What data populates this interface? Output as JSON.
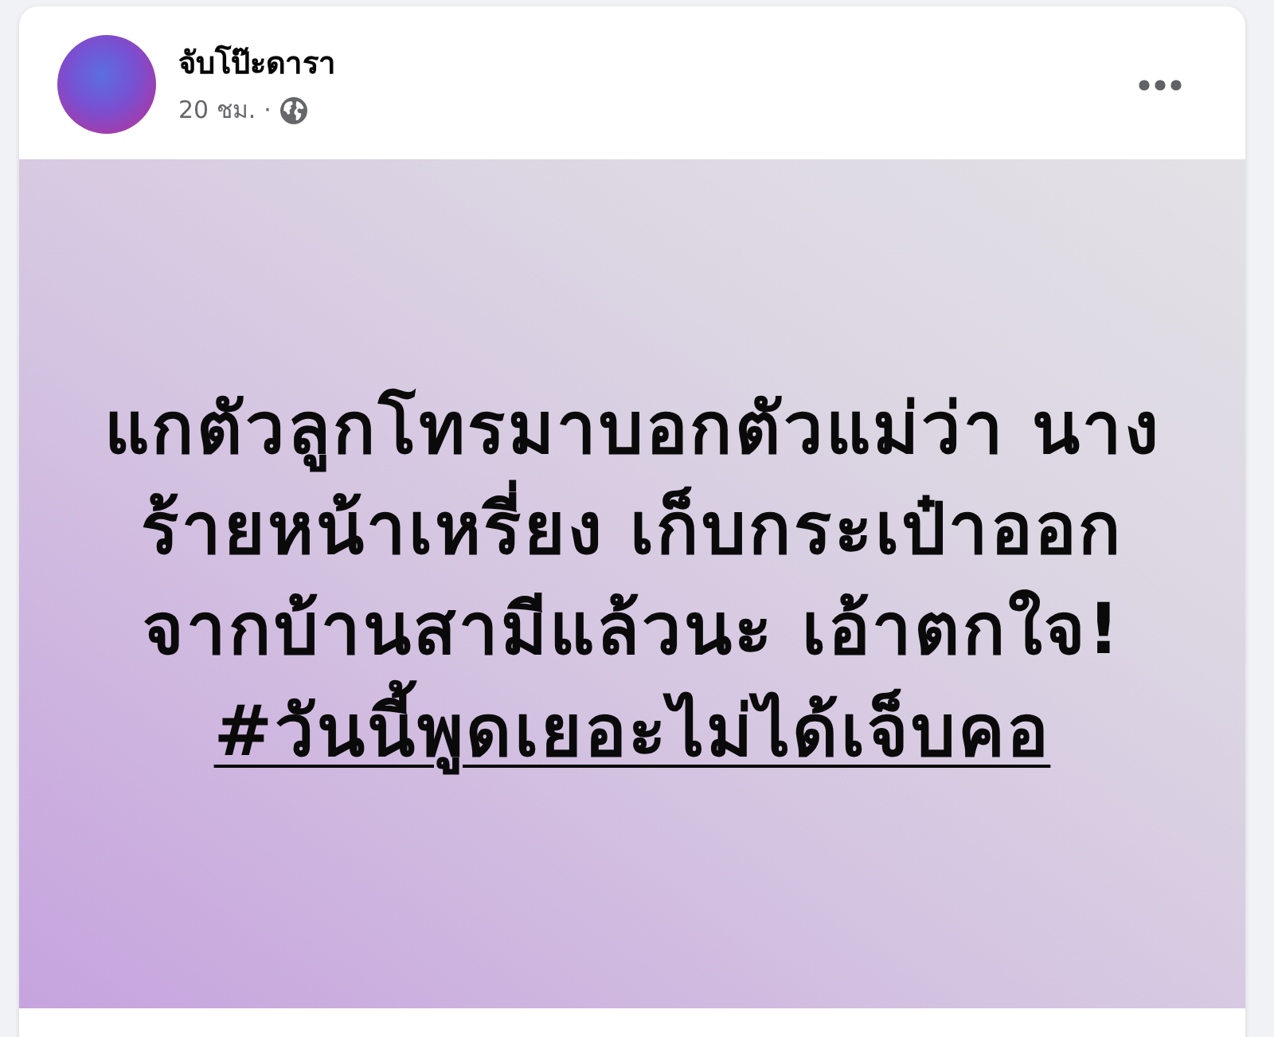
{
  "post": {
    "author": "จับโป๊ะดารา",
    "time": "20 ชม.",
    "separator": "·",
    "background_text": {
      "lines": [
        "แกตัวลูกโทรมาบอกตัวแม่ว่า นาง",
        "ร้ายหน้าเหรี่ยง เก็บกระเป๋าออก",
        "จากบ้านสามีแล้วนะ เอ้าตกใจ!"
      ],
      "hashtag": "#วันนี้พูดเยอะไม่ได้เจ็บคอ"
    }
  }
}
